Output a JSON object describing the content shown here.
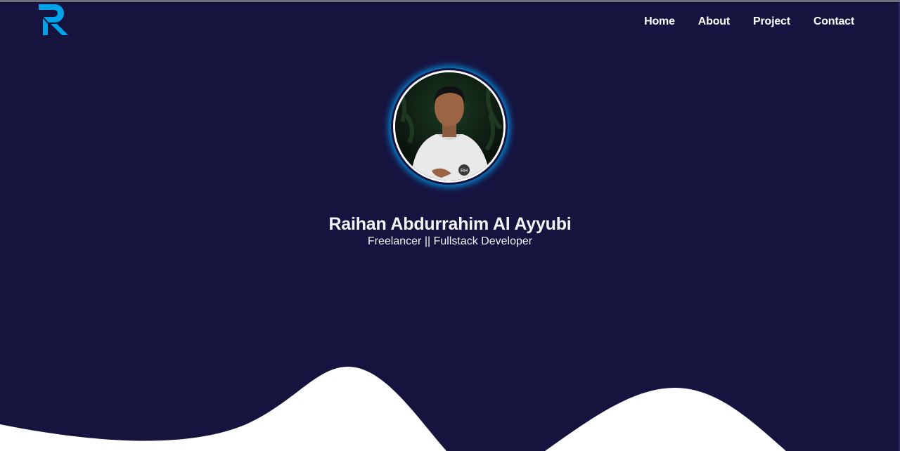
{
  "nav": {
    "logo_icon": "r-logo-icon",
    "items": [
      {
        "label": "Home"
      },
      {
        "label": "About"
      },
      {
        "label": "Project"
      },
      {
        "label": "Contact"
      }
    ]
  },
  "hero": {
    "name": "Raihan Abdurrahim Al Ayyubi",
    "subtitle": "Freelancer || Fullstack Developer"
  },
  "colors": {
    "background": "#16133f",
    "accent": "#00a3e8",
    "wave": "#ffffff"
  }
}
